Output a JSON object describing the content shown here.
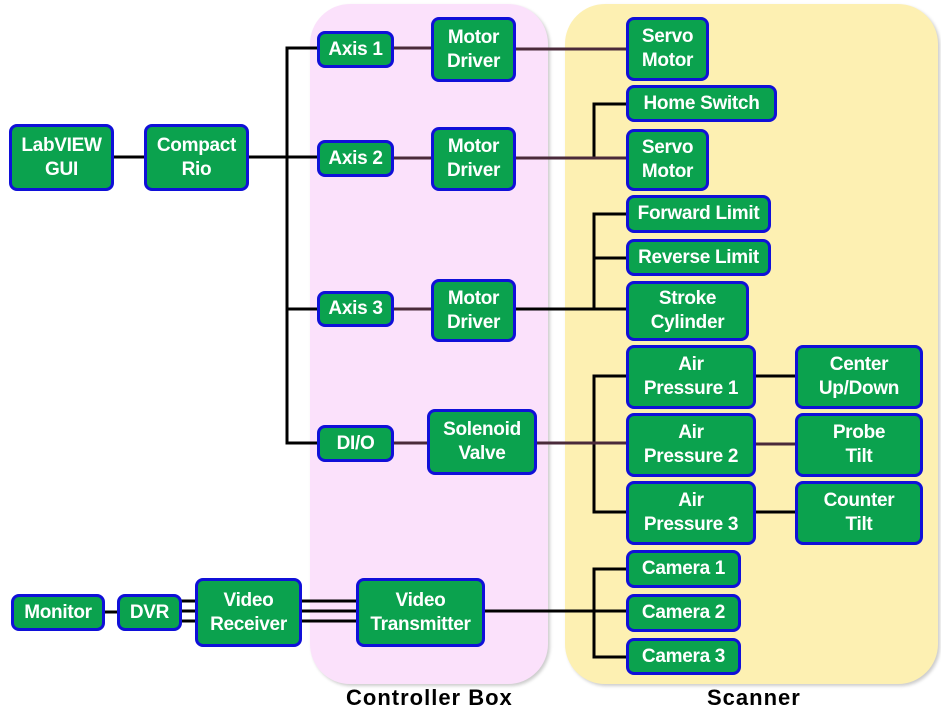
{
  "regions": {
    "controller": "Controller  Box",
    "scanner": "Scanner"
  },
  "colors": {
    "box_fill": "#0ba24e",
    "box_border": "#1010d8",
    "controller_bg": "#fbe1fb",
    "scanner_bg": "#fdf0b2"
  },
  "nodes": {
    "labview": "LabVIEW\nGUI",
    "compactrio": "Compact\nRio",
    "axis1": "Axis 1",
    "axis2": "Axis 2",
    "axis3": "Axis 3",
    "dio": "DI/O",
    "md1": "Motor\nDriver",
    "md2": "Motor\nDriver",
    "md3": "Motor\nDriver",
    "solenoid": "Solenoid\nValve",
    "servo1": "Servo\nMotor",
    "home": "Home Switch",
    "servo2": "Servo\nMotor",
    "fwd": "Forward Limit",
    "rev": "Reverse Limit",
    "stroke": "Stroke\nCylinder",
    "ap1": "Air\nPressure 1",
    "ap2": "Air\nPressure 2",
    "ap3": "Air\nPressure 3",
    "center": "Center\nUp/Down",
    "probe": "Probe\nTilt",
    "counter": "Counter\nTilt",
    "cam1": "Camera 1",
    "cam2": "Camera 2",
    "cam3": "Camera 3",
    "monitor": "Monitor",
    "dvr": "DVR",
    "vrx": "Video\nReceiver",
    "vtx": "Video\nTransmitter"
  }
}
